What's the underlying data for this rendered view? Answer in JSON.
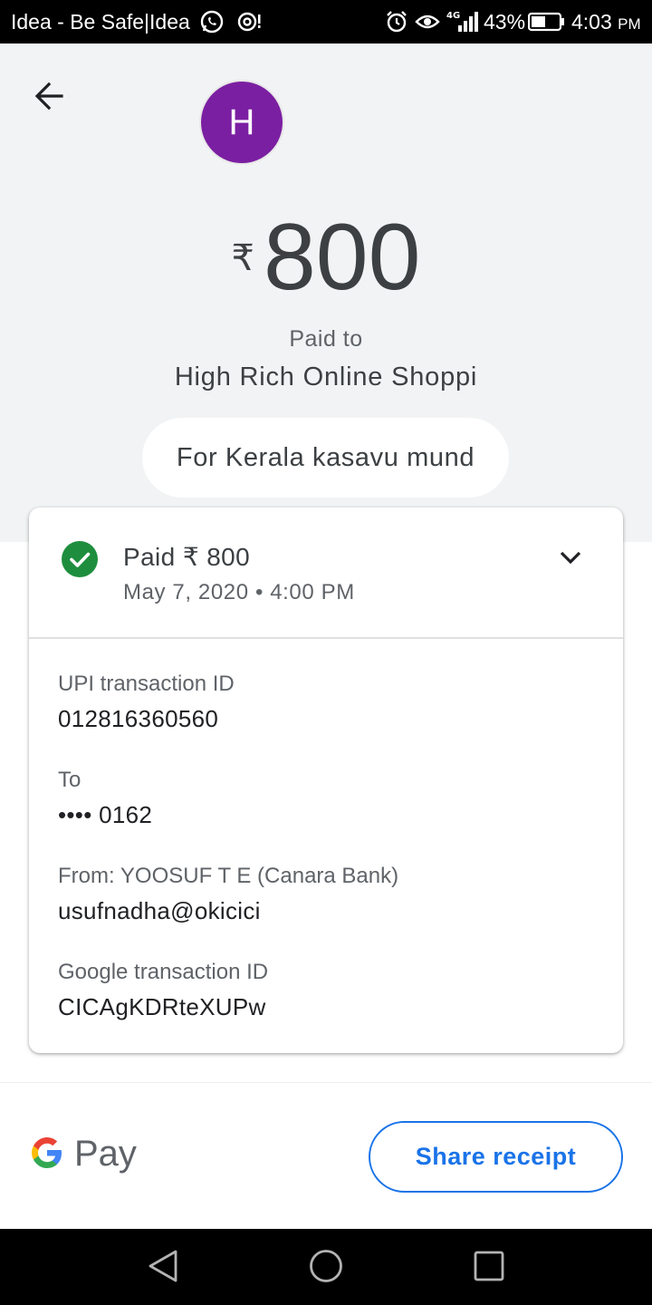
{
  "status_bar": {
    "carrier": "Idea - Be Safe|Idea",
    "network": "4G",
    "battery_percent": "43%",
    "time": "4:03",
    "ampm": "PM"
  },
  "header": {
    "avatar_letter": "H",
    "avatar_color": "#7b1fa2",
    "currency_symbol": "₹",
    "amount": "800",
    "paid_to_label": "Paid to",
    "payee_name": "High Rich Online Shoppi",
    "note": "For Kerala kasavu mund"
  },
  "transaction": {
    "status_title": "Paid ₹ 800",
    "status_date": "May 7, 2020 • 4:00 PM",
    "status_color": "#1e8e3e",
    "details": [
      {
        "label": "UPI transaction ID",
        "value": "012816360560"
      },
      {
        "label": "To",
        "value": "•••• 0162"
      },
      {
        "label": "From: YOOSUF T E (Canara Bank)",
        "value": "usufnadha@okicici"
      },
      {
        "label": "Google transaction ID",
        "value": "CICAgKDRteXUPw"
      }
    ]
  },
  "footer": {
    "brand_text": "Pay",
    "share_label": "Share receipt",
    "accent_color": "#1a73e8"
  }
}
